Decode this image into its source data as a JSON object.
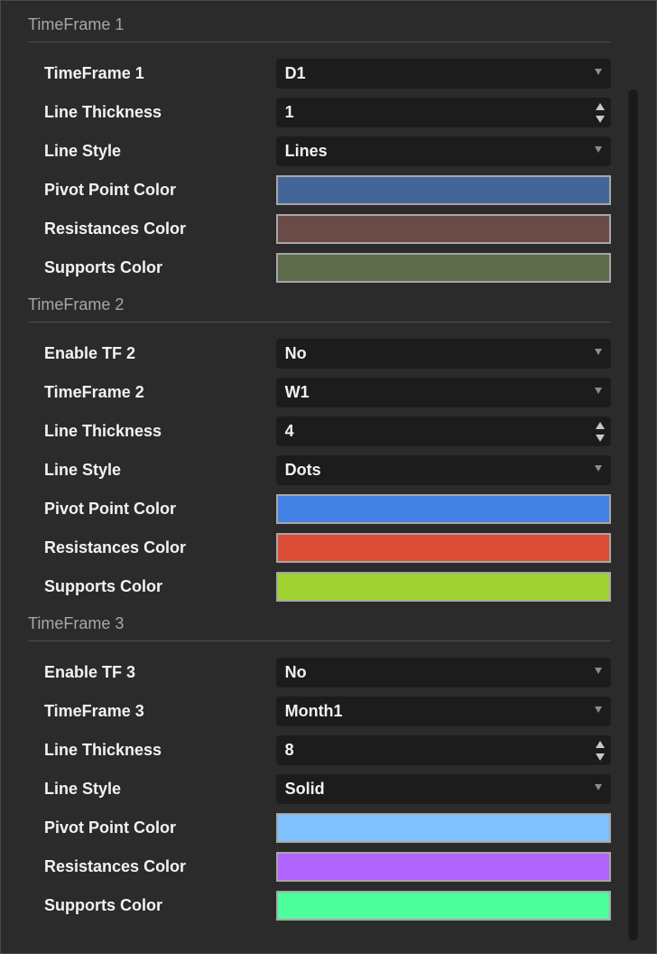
{
  "sections": [
    {
      "title": "TimeFrame 1",
      "rows": [
        {
          "label": "TimeFrame 1",
          "type": "select",
          "value": "D1"
        },
        {
          "label": "Line Thickness",
          "type": "number",
          "value": "1"
        },
        {
          "label": "Line Style",
          "type": "select",
          "value": "Lines"
        },
        {
          "label": "Pivot Point Color",
          "type": "color",
          "color": "#44659a"
        },
        {
          "label": "Resistances Color",
          "type": "color",
          "color": "#6b4b47"
        },
        {
          "label": "Supports Color",
          "type": "color",
          "color": "#5d6b4b"
        }
      ]
    },
    {
      "title": "TimeFrame 2",
      "rows": [
        {
          "label": "Enable TF 2",
          "type": "select",
          "value": "No"
        },
        {
          "label": "TimeFrame 2",
          "type": "select",
          "value": "W1"
        },
        {
          "label": "Line Thickness",
          "type": "number",
          "value": "4"
        },
        {
          "label": "Line Style",
          "type": "select",
          "value": "Dots"
        },
        {
          "label": "Pivot Point Color",
          "type": "color",
          "color": "#4481e5"
        },
        {
          "label": "Resistances Color",
          "type": "color",
          "color": "#dc4d37"
        },
        {
          "label": "Supports Color",
          "type": "color",
          "color": "#a0d232"
        }
      ]
    },
    {
      "title": "TimeFrame 3",
      "rows": [
        {
          "label": "Enable TF 3",
          "type": "select",
          "value": "No"
        },
        {
          "label": "TimeFrame 3",
          "type": "select",
          "value": "Month1"
        },
        {
          "label": "Line Thickness",
          "type": "number",
          "value": "8"
        },
        {
          "label": "Line Style",
          "type": "select",
          "value": "Solid"
        },
        {
          "label": "Pivot Point Color",
          "type": "color",
          "color": "#80c2ff"
        },
        {
          "label": "Resistances Color",
          "type": "color",
          "color": "#b264ff"
        },
        {
          "label": "Supports Color",
          "type": "color",
          "color": "#4dff9c"
        }
      ]
    }
  ],
  "icons": {
    "select": "chevron-down-icon",
    "number": "spinner-icon"
  }
}
